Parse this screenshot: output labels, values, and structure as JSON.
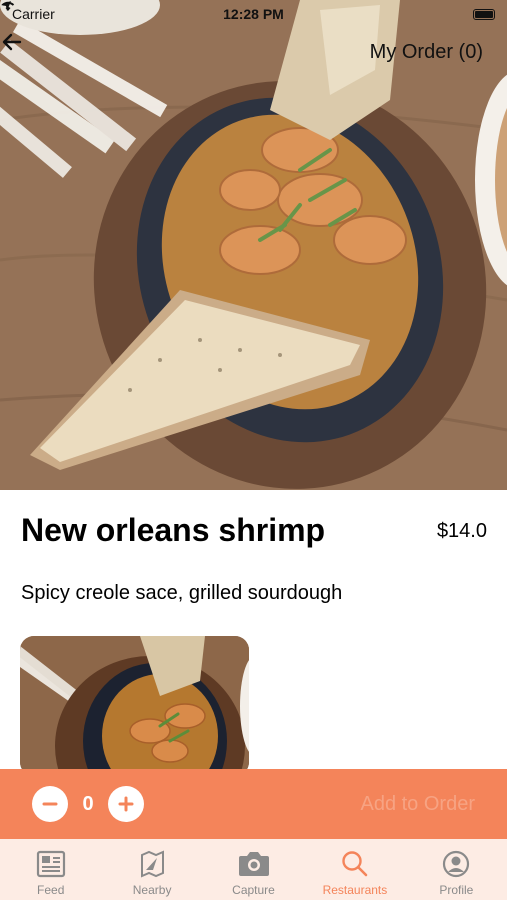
{
  "status_bar": {
    "carrier": "Carrier",
    "time": "12:28 PM"
  },
  "nav": {
    "back_icon": "arrow-left-icon",
    "my_order": "My Order (0)"
  },
  "dish": {
    "title": "New orleans shrimp",
    "price": "$14.0",
    "description": "Spicy creole sace, grilled sourdough"
  },
  "order_bar": {
    "quantity": "0",
    "add_label": "Add to Order",
    "accent": "#f4845a"
  },
  "tabs": [
    {
      "label": "Feed",
      "icon": "feed-icon",
      "active": false
    },
    {
      "label": "Nearby",
      "icon": "nearby-icon",
      "active": false
    },
    {
      "label": "Capture",
      "icon": "camera-icon",
      "active": false
    },
    {
      "label": "Restaurants",
      "icon": "search-icon",
      "active": true
    },
    {
      "label": "Profile",
      "icon": "profile-icon",
      "active": false
    }
  ]
}
